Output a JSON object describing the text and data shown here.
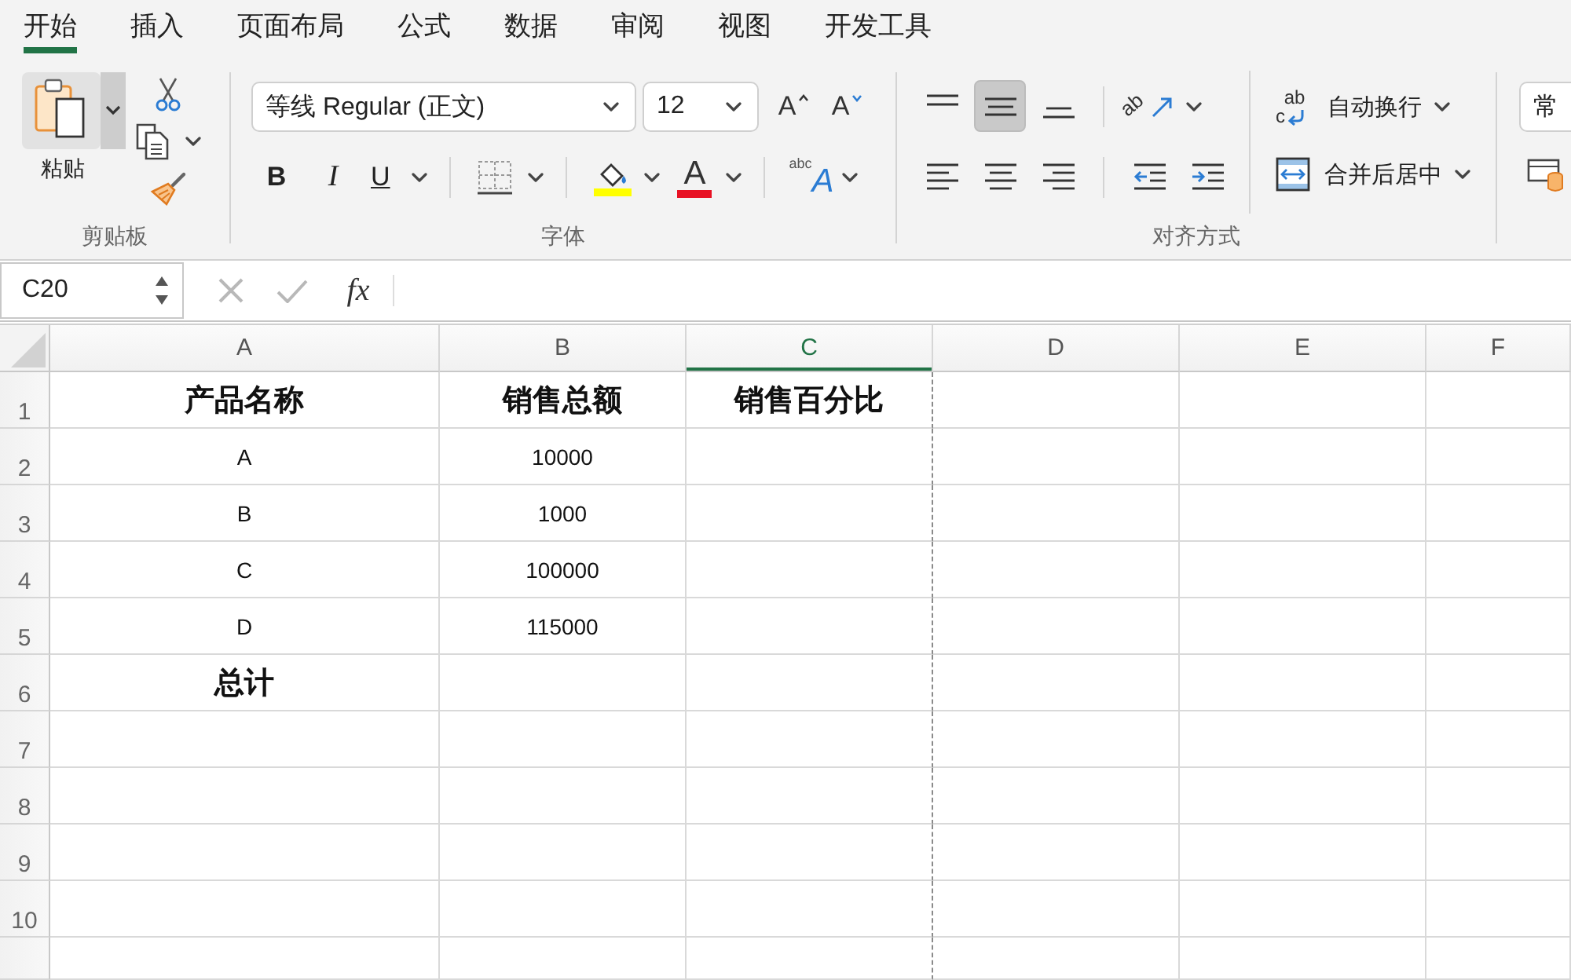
{
  "ribbon_tabs": [
    {
      "label": "开始",
      "selected": true
    },
    {
      "label": "插入",
      "selected": false
    },
    {
      "label": "页面布局",
      "selected": false
    },
    {
      "label": "公式",
      "selected": false
    },
    {
      "label": "数据",
      "selected": false
    },
    {
      "label": "审阅",
      "selected": false
    },
    {
      "label": "视图",
      "selected": false
    },
    {
      "label": "开发工具",
      "selected": false
    }
  ],
  "clipboard": {
    "paste_label": "粘贴",
    "group_label": "剪贴板"
  },
  "font": {
    "font_name": "等线 Regular (正文)",
    "font_size": "12",
    "grow_glyph": "A",
    "shrink_glyph": "A",
    "styles": [
      {
        "kind": "bold",
        "glyph": "B"
      },
      {
        "kind": "italic",
        "glyph": "I"
      },
      {
        "kind": "underline",
        "glyph": "U"
      }
    ],
    "font_color_glyph": "A",
    "effects_glyph_small": "abc",
    "effects_glyph_large": "A",
    "group_label": "字体"
  },
  "alignment": {
    "vertical": [
      {
        "kind": "top",
        "selected": false
      },
      {
        "kind": "middle",
        "selected": true
      },
      {
        "kind": "bottom",
        "selected": false
      }
    ],
    "orientation_glyph": "ab",
    "horizontal": [
      {
        "kind": "left",
        "selected": false
      },
      {
        "kind": "center",
        "selected": false
      },
      {
        "kind": "right",
        "selected": false
      }
    ],
    "wrap_glyph_top": "ab",
    "wrap_glyph_bottom": "c",
    "wrap_label": "自动换行",
    "merge_label": "合并后居中",
    "group_label": "对齐方式"
  },
  "number": {
    "format": "常"
  },
  "formula_bar": {
    "name_box": "C20",
    "function_glyph": "fx"
  },
  "sheet": {
    "columns": [
      {
        "label": "A",
        "selected": false
      },
      {
        "label": "B",
        "selected": false
      },
      {
        "label": "C",
        "selected": true
      },
      {
        "label": "D",
        "selected": false
      },
      {
        "label": "E",
        "selected": false
      },
      {
        "label": "F",
        "selected": false
      }
    ],
    "rows": [
      {
        "number": "1",
        "bold": true,
        "cells": [
          "产品名称",
          "销售总额",
          "销售百分比"
        ]
      },
      {
        "number": "2",
        "bold": false,
        "cells": [
          "A",
          "10000"
        ]
      },
      {
        "number": "3",
        "bold": false,
        "cells": [
          "B",
          "1000"
        ]
      },
      {
        "number": "4",
        "bold": false,
        "cells": [
          "C",
          "100000"
        ]
      },
      {
        "number": "5",
        "bold": false,
        "cells": [
          "D",
          "115000"
        ]
      },
      {
        "number": "6",
        "bold": true,
        "cells": [
          "总计"
        ]
      },
      {
        "number": "7"
      },
      {
        "number": "8"
      },
      {
        "number": "9"
      },
      {
        "number": "10"
      }
    ]
  }
}
